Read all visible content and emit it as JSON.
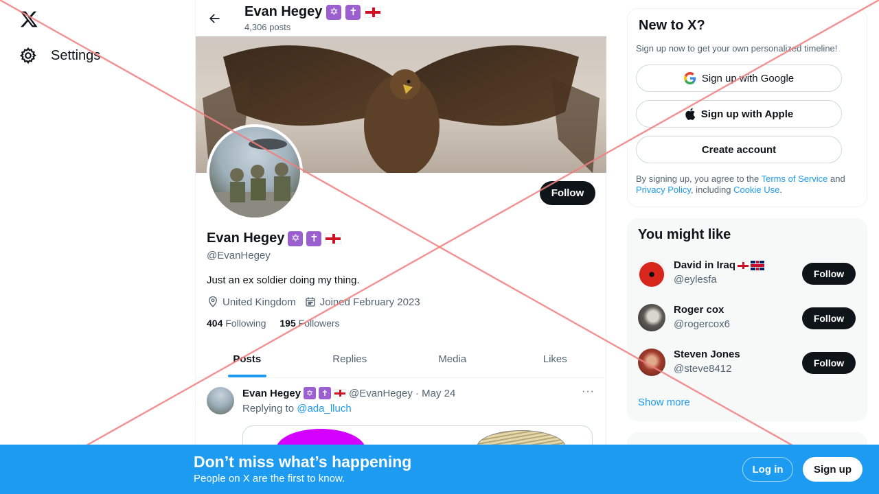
{
  "leftnav": {
    "logo_icon": "x-logo-icon",
    "settings_label": "Settings"
  },
  "topbar": {
    "name": "Evan Hegey",
    "post_count": "4,306 posts"
  },
  "profile": {
    "name": "Evan Hegey",
    "handle": "@EvanHegey",
    "bio": "Just an ex soldier doing my thing.",
    "location": "United Kingdom",
    "joined": "Joined February 2023",
    "following_count": "404",
    "following_label": "Following",
    "followers_count": "195",
    "followers_label": "Followers",
    "follow_label": "Follow",
    "emojis": [
      "✡",
      "✝"
    ]
  },
  "tabs": [
    {
      "label": "Posts",
      "active": true
    },
    {
      "label": "Replies",
      "active": false
    },
    {
      "label": "Media",
      "active": false
    },
    {
      "label": "Likes",
      "active": false
    }
  ],
  "tweet": {
    "name": "Evan Hegey",
    "handle_date": "@EvanHegey · May 24",
    "replying_prefix": "Replying to",
    "replying_to": "@ada_lluch",
    "more": "···"
  },
  "new_to_x": {
    "title": "New to X?",
    "subtitle": "Sign up now to get your own personalized timeline!",
    "google_label": "Sign up with Google",
    "apple_label": "Sign up with Apple",
    "create_label": "Create account",
    "legal_1": "By signing up, you agree to the ",
    "terms": "Terms of Service",
    "legal_2": " and ",
    "privacy": "Privacy Policy",
    "legal_3": ", including ",
    "cookie": "Cookie Use",
    "legal_4": "."
  },
  "you_might_like": {
    "title": "You might like",
    "people": [
      {
        "name": "David in Iraq",
        "handle": "@eylesfa",
        "follow": "Follow"
      },
      {
        "name": "Roger cox",
        "handle": "@rogercox6",
        "follow": "Follow"
      },
      {
        "name": "Steven Jones",
        "handle": "@steve8412",
        "follow": "Follow"
      }
    ],
    "show_more": "Show more"
  },
  "bottom_bar": {
    "title": "Don’t miss what’s happening",
    "subtitle": "People on X are the first to know.",
    "login": "Log in",
    "signup": "Sign up"
  },
  "colors": {
    "accent": "#1d9bf0",
    "text": "#0f1419",
    "muted": "#536471",
    "overlay_cross": "#f08080"
  }
}
